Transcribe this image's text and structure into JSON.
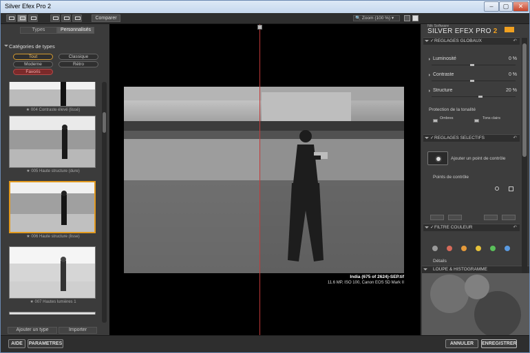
{
  "window": {
    "title": "Silver Efex Pro 2",
    "controls": [
      "–",
      "▢",
      "✕"
    ]
  },
  "toolbar": {
    "compare_label": "Comparer",
    "zoom_label": "Zoom (100 %)"
  },
  "left": {
    "tabs": [
      "Types",
      "Personnalisés"
    ],
    "categories_title": "Catégories de types",
    "categories": [
      "Tout",
      "Classique",
      "Moderne",
      "Rétro",
      "Favoris"
    ],
    "thumbs": [
      {
        "label": "★ 004 Contraste élevé (lissé)"
      },
      {
        "label": "★ 005 Haute structure (dure)"
      },
      {
        "label": "★ 006 Haute structure (lisse)"
      },
      {
        "label": "★ 007 Hautes lumières 1"
      },
      {
        "label": ""
      }
    ],
    "add_type_label": "Ajouter un type",
    "import_label": "Importer"
  },
  "photo": {
    "filename": "India (675 of 2624)-SEP.tif",
    "meta": "11.6 MP, ISO 100, Canon EOS 5D Mark II"
  },
  "right": {
    "nik": "Nik Software",
    "product": "SILVER EFEX PRO",
    "version": "2",
    "global_header": "REGLAGES GLOBAUX",
    "sliders": [
      {
        "label": "Luminosité",
        "value": "0 %"
      },
      {
        "label": "Contraste",
        "value": "0 %"
      },
      {
        "label": "Structure",
        "value": "20 %"
      }
    ],
    "tone_protect": "Protection de la tonalité",
    "shadows": "Ombres",
    "highlights": "Tons clairs",
    "selective_header": "REGLAGES SELECTIFS",
    "add_control_point": "Ajouter un point de contrôle",
    "control_points": "Points de contrôle",
    "filter_header": "FILTRE COULEUR",
    "filter_colors": [
      "#9a9a9a",
      "#d76a5a",
      "#e69a3a",
      "#e6c23a",
      "#5ac05a",
      "#5a9ae0"
    ],
    "details": "Détails",
    "loupe_header": "LOUPE & HISTOGRAMME"
  },
  "bottom": {
    "help": "AIDE",
    "settings": "PARAMETRES",
    "cancel": "ANNULER",
    "save": "ENREGISTRER"
  }
}
